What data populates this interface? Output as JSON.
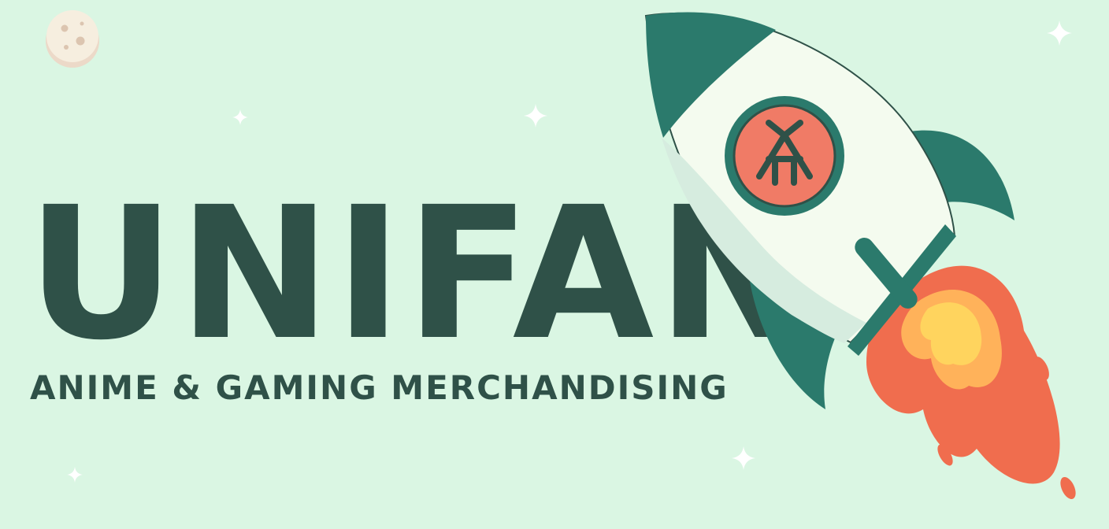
{
  "banner": {
    "brand_name": "UNIFAN",
    "tagline": "ANIME & GAMING MERCHANDISING"
  },
  "decorations": {
    "icons": [
      "moon-icon",
      "sparkle-icon",
      "rocket-icon",
      "brand-emblem-icon",
      "rocket-flame-icon"
    ]
  },
  "colors": {
    "background": "#daf6e3",
    "text": "#2f5148",
    "rocket_teal": "#2b7a6c",
    "rocket_body": "#f4fbef",
    "emblem_coral": "#f07b66",
    "flame_orange": "#f06d4e",
    "flame_yellow": "#ffd45e",
    "moon": "#f6eedf"
  }
}
